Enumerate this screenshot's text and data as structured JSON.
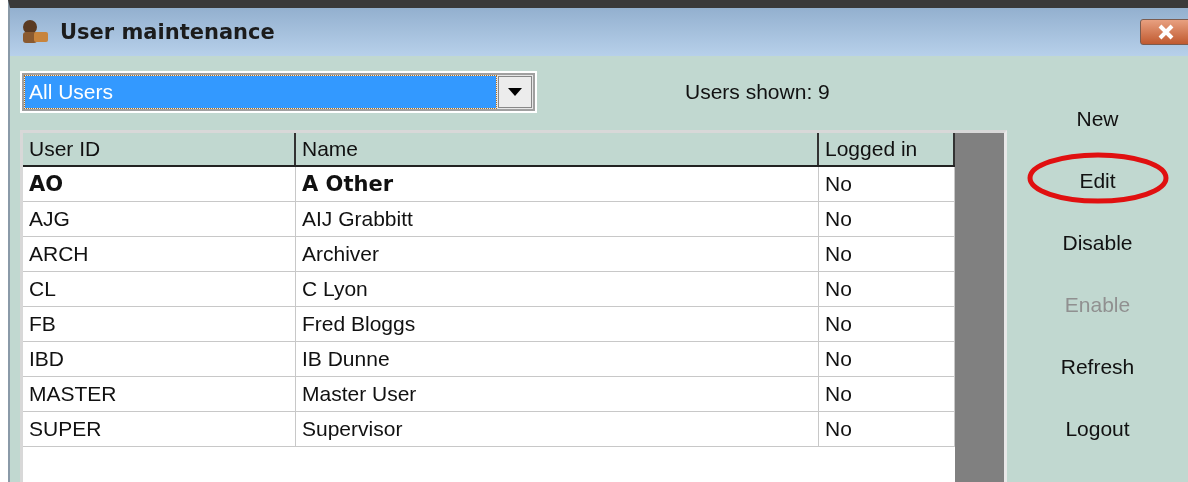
{
  "window": {
    "title": "User maintenance"
  },
  "filter": {
    "value": "All Users"
  },
  "users_shown": "Users shown: 9",
  "table": {
    "columns": [
      "User ID",
      "Name",
      "Logged in"
    ],
    "rows": [
      {
        "cells": [
          "AO",
          "A Other",
          "No"
        ],
        "bold": true
      },
      {
        "cells": [
          "AJG",
          "AIJ Grabbitt",
          "No"
        ],
        "bold": false
      },
      {
        "cells": [
          "ARCH",
          "Archiver",
          "No"
        ],
        "bold": false
      },
      {
        "cells": [
          "CL",
          "C Lyon",
          "No"
        ],
        "bold": false
      },
      {
        "cells": [
          "FB",
          "Fred Bloggs",
          "No"
        ],
        "bold": false
      },
      {
        "cells": [
          "IBD",
          "IB Dunne",
          "No"
        ],
        "bold": false
      },
      {
        "cells": [
          "MASTER",
          "Master User",
          "No"
        ],
        "bold": false
      },
      {
        "cells": [
          "SUPER",
          "Supervisor",
          "No"
        ],
        "bold": false
      }
    ]
  },
  "buttons": [
    {
      "label": "New",
      "disabled": false,
      "circled": false
    },
    {
      "label": "Edit",
      "disabled": false,
      "circled": true
    },
    {
      "label": "Disable",
      "disabled": false,
      "circled": false
    },
    {
      "label": "Enable",
      "disabled": true,
      "circled": false
    },
    {
      "label": "Refresh",
      "disabled": false,
      "circled": false
    },
    {
      "label": "Logout",
      "disabled": false,
      "circled": false
    }
  ]
}
